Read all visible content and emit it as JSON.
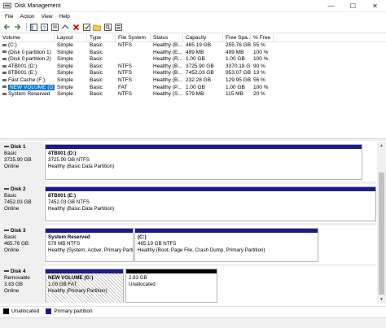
{
  "window": {
    "title": "Disk Management",
    "min": "—",
    "max": "☐",
    "close": "✕"
  },
  "menu": [
    "File",
    "Action",
    "View",
    "Help"
  ],
  "toolbar": {
    "colors": {
      "delete": "#cc0000"
    }
  },
  "table": {
    "headers": [
      "Volume",
      "Layout",
      "Type",
      "File System",
      "Status",
      "Capacity",
      "Free Spa...",
      "% Free"
    ],
    "rows": [
      {
        "volume": "(C:)",
        "layout": "Simple",
        "type": "Basic",
        "fs": "NTFS",
        "status": "Healthy (B...",
        "capacity": "465.19 GB",
        "free": "255.76 GB",
        "pct": "55 %"
      },
      {
        "volume": "(Disk 0 partition 1)",
        "layout": "Simple",
        "type": "Basic",
        "fs": "",
        "status": "Healthy (E...",
        "capacity": "499 MB",
        "free": "499 MB",
        "pct": "100 %"
      },
      {
        "volume": "(Disk 0 partition 2)",
        "layout": "Simple",
        "type": "Basic",
        "fs": "",
        "status": "Healthy (R...",
        "capacity": "1.00 GB",
        "free": "1.00 GB",
        "pct": "100 %"
      },
      {
        "volume": "4TB001 (D:)",
        "layout": "Simple",
        "type": "Basic",
        "fs": "NTFS",
        "status": "Healthy (B...",
        "capacity": "3725.90 GB",
        "free": "3370.18 GB",
        "pct": "90 %"
      },
      {
        "volume": "8TB001 (E:)",
        "layout": "Simple",
        "type": "Basic",
        "fs": "NTFS",
        "status": "Healthy (B...",
        "capacity": "7452.03 GB",
        "free": "953.07 GB",
        "pct": "13 %"
      },
      {
        "volume": "Fast Cache (F:)",
        "layout": "Simple",
        "type": "Basic",
        "fs": "NTFS",
        "status": "Healthy (B...",
        "capacity": "232.28 GB",
        "free": "129.95 GB",
        "pct": "56 %"
      },
      {
        "volume": "NEW VOLUME (G:)",
        "layout": "Simple",
        "type": "Basic",
        "fs": "FAT",
        "status": "Healthy (P...",
        "capacity": "1.00 GB",
        "free": "1.00 GB",
        "pct": "100 %"
      },
      {
        "volume": "System Reserved",
        "layout": "Simple",
        "type": "Basic",
        "fs": "NTFS",
        "status": "Healthy (S...",
        "capacity": "579 MB",
        "free": "115 MB",
        "pct": "20 %"
      }
    ]
  },
  "disks": [
    {
      "name": "Disk 1",
      "type": "Basic",
      "size": "3725.90 GB",
      "state": "Online",
      "partitions": [
        {
          "label": "4TB001  (D:)",
          "line1": "3725.90 GB NTFS",
          "line2": "Healthy (Basic Data Partition)"
        }
      ]
    },
    {
      "name": "Disk 2",
      "type": "Basic",
      "size": "7452.03 GB",
      "state": "Online",
      "partitions": [
        {
          "label": "8TB001  (E:)",
          "line1": "7452.03 GB NTFS",
          "line2": "Healthy (Basic Data Partition)"
        }
      ]
    },
    {
      "name": "Disk 3",
      "type": "Basic",
      "size": "465.76 GB",
      "state": "Online",
      "partitions": [
        {
          "label": "System Reserved",
          "line1": "579 MB NTFS",
          "line2": "Healthy (System, Active, Primary Parti"
        },
        {
          "label": "(C:)",
          "line1": "465.19 GB NTFS",
          "line2": "Healthy (Boot, Page File, Crash Dump, Primary Partition)"
        }
      ]
    },
    {
      "name": "Disk 4",
      "type": "Removable",
      "size": "3.83 GB",
      "state": "Online",
      "partitions": [
        {
          "label": "NEW VOLUME  (G:)",
          "line1": "1.00 GB FAT",
          "line2": "Healthy (Primary Partition)"
        },
        {
          "label": "",
          "line1": "2.83 GB",
          "line2": "Unallocated"
        }
      ]
    }
  ],
  "legend": {
    "unallocated": "Unallocated",
    "primary": "Primary partition",
    "colors": {
      "unallocated": "#000000",
      "primary": "#1c1c86"
    }
  }
}
